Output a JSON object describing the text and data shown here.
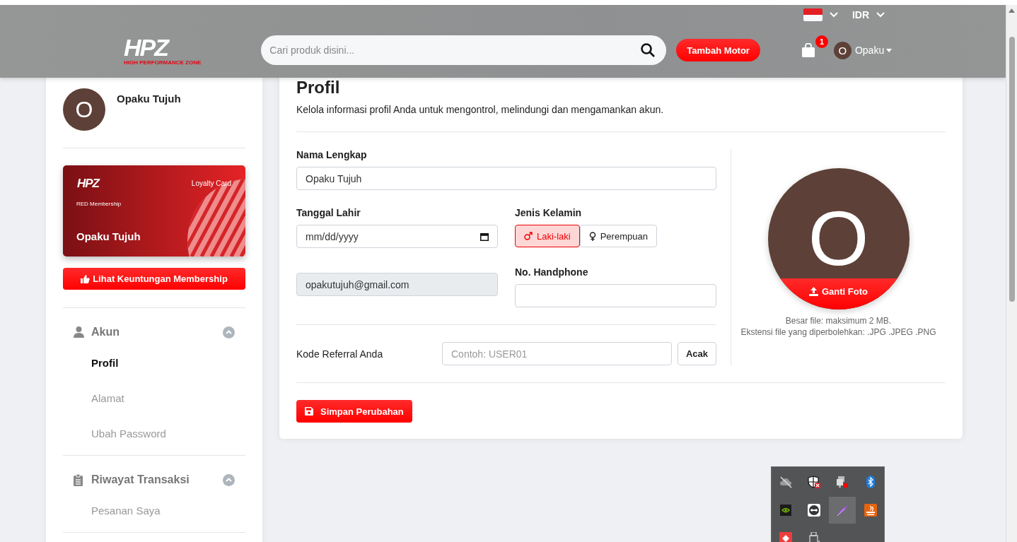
{
  "top_bar": {
    "currency": "IDR"
  },
  "header": {
    "logo": "HPZ",
    "logo_tagline": "HIGH PERFORMANCE ZONE",
    "search": {
      "placeholder": "Cari produk disini..."
    },
    "add_motor_button": "Tambah Motor",
    "cart_badge": "1",
    "user": {
      "initial": "O",
      "name": "Opaku"
    }
  },
  "sidebar": {
    "user": {
      "initial": "O",
      "name": "Opaku Tujuh"
    },
    "loyalty_card": {
      "logo": "HPZ",
      "label": "Loyalty Card",
      "tier": "RED Membership",
      "holder": "Opaku Tujuh"
    },
    "benefits_button": "Lihat Keuntungan Membership",
    "sections": [
      {
        "title": "Akun",
        "kind": "user",
        "expanded": true,
        "items": [
          {
            "label": "Profil",
            "selected": true
          },
          {
            "label": "Alamat",
            "selected": false
          },
          {
            "label": "Ubah Password",
            "selected": false
          }
        ]
      },
      {
        "title": "Riwayat Transaksi",
        "kind": "clipboard",
        "expanded": true,
        "items": [
          {
            "label": "Pesanan Saya",
            "selected": false
          }
        ]
      }
    ]
  },
  "profile": {
    "title": "Profil",
    "subtitle": "Kelola informasi profil Anda untuk mengontrol, melindungi dan mengamankan akun.",
    "full_name": {
      "label": "Nama Lengkap",
      "value": "Opaku Tujuh"
    },
    "birth_date": {
      "label": "Tanggal Lahir",
      "placeholder": "mm/dd/yyyy"
    },
    "gender": {
      "label": "Jenis Kelamin",
      "options": [
        {
          "label": "Laki-laki",
          "kind": "male",
          "selected": true
        },
        {
          "label": "Perempuan",
          "kind": "female",
          "selected": false
        }
      ]
    },
    "email": {
      "value": "opakutujuh@gmail.com",
      "disabled": true
    },
    "phone": {
      "label": "No. Handphone"
    },
    "referral": {
      "label": "Kode Referral Anda",
      "placeholder": "Contoh: USER01",
      "button": "Acak"
    },
    "save_button": "Simpan Perubahan",
    "photo": {
      "initial": "O",
      "button": "Ganti Foto",
      "notes": [
        "Besar file: maksimum 2 MB.",
        "Ekstensi file yang diperbolehkan: .JPG .JPEG .PNG"
      ]
    }
  },
  "tray": {
    "icons": [
      {
        "kind": "cloud-off",
        "selected": false
      },
      {
        "kind": "shield",
        "selected": false
      },
      {
        "kind": "computers",
        "selected": false
      },
      {
        "kind": "bluetooth",
        "selected": false
      },
      {
        "kind": "chip",
        "selected": false
      },
      {
        "kind": "remote",
        "selected": false
      },
      {
        "kind": "feather",
        "selected": true
      },
      {
        "kind": "flame",
        "selected": false
      },
      {
        "kind": "red-app",
        "selected": false
      },
      {
        "kind": "usb",
        "selected": false
      }
    ]
  }
}
